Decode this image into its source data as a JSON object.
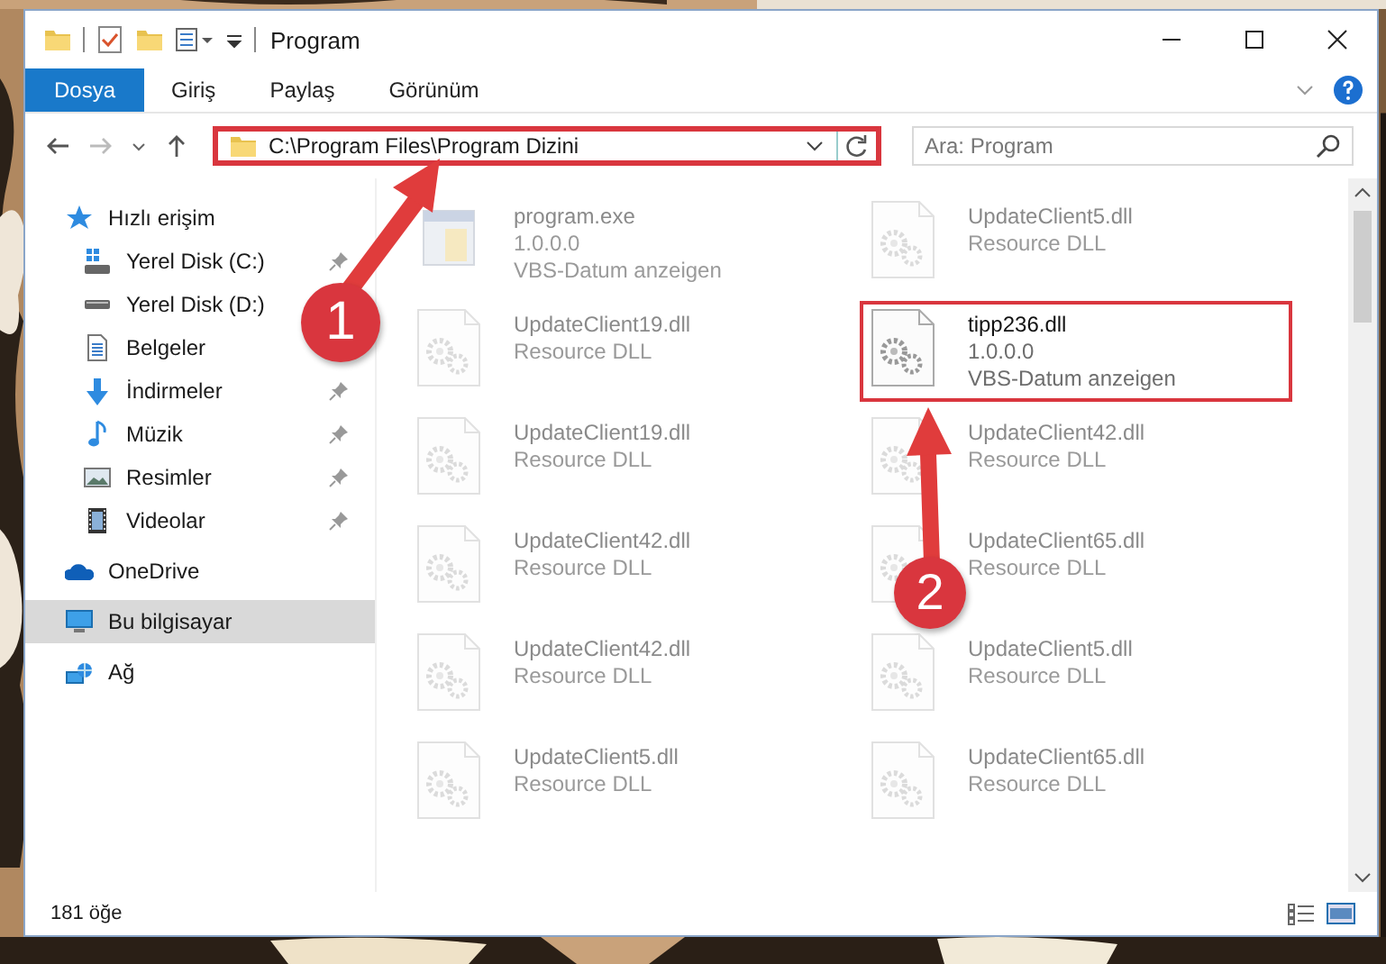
{
  "window": {
    "title": "Program"
  },
  "ribbon_tabs": [
    {
      "label": "Dosya",
      "selected": true
    },
    {
      "label": "Giriş",
      "selected": false
    },
    {
      "label": "Paylaş",
      "selected": false
    },
    {
      "label": "Görünüm",
      "selected": false
    }
  ],
  "address_bar": {
    "value": "C:\\Program Files\\Program Dizini",
    "highlighted": true
  },
  "search": {
    "placeholder": "Ara: Program"
  },
  "sidebar": {
    "items": [
      {
        "label": "Hızlı erişim",
        "kind": "star",
        "selected": false,
        "children": [
          {
            "label": "Yerel Disk (C:)",
            "kind": "drive-win",
            "pinned": true,
            "selected": false
          },
          {
            "label": "Yerel Disk (D:)",
            "kind": "drive",
            "selected": false
          },
          {
            "label": "Belgeler",
            "kind": "document",
            "selected": false
          },
          {
            "label": "İndirmeler",
            "kind": "download",
            "pinned": true,
            "selected": false
          },
          {
            "label": "Müzik",
            "kind": "music",
            "pinned": true,
            "selected": false
          },
          {
            "label": "Resimler",
            "kind": "pictures",
            "pinned": true,
            "selected": false
          },
          {
            "label": "Videolar",
            "kind": "video",
            "pinned": true,
            "selected": false
          }
        ]
      },
      {
        "label": "OneDrive",
        "kind": "cloud",
        "selected": false
      },
      {
        "label": "Bu bilgisayar",
        "kind": "computer",
        "selected": true
      },
      {
        "label": "Ağ",
        "kind": "network",
        "selected": false
      }
    ]
  },
  "files": [
    {
      "name": "program.exe",
      "kind": "exe",
      "details": [
        "1.0.0.0",
        "VBS-Datum anzeigen"
      ],
      "highlighted": false
    },
    {
      "name": "UpdateClient5.dll",
      "kind": "dll",
      "details": [
        "Resource DLL"
      ],
      "highlighted": false
    },
    {
      "name": "UpdateClient19.dll",
      "kind": "dll",
      "details": [
        "Resource DLL"
      ],
      "highlighted": false
    },
    {
      "name": "tipp236.dll",
      "kind": "dll",
      "details": [
        "1.0.0.0",
        "VBS-Datum anzeigen"
      ],
      "highlighted": true
    },
    {
      "name": "UpdateClient19.dll",
      "kind": "dll",
      "details": [
        "Resource DLL"
      ],
      "highlighted": false
    },
    {
      "name": "UpdateClient42.dll",
      "kind": "dll",
      "details": [
        "Resource DLL"
      ],
      "highlighted": false
    },
    {
      "name": "UpdateClient42.dll",
      "kind": "dll",
      "details": [
        "Resource DLL"
      ],
      "highlighted": false
    },
    {
      "name": "UpdateClient65.dll",
      "kind": "dll",
      "details": [
        "Resource DLL"
      ],
      "highlighted": false
    },
    {
      "name": "UpdateClient42.dll",
      "kind": "dll",
      "details": [
        "Resource DLL"
      ],
      "highlighted": false
    },
    {
      "name": "UpdateClient5.dll",
      "kind": "dll",
      "details": [
        "Resource DLL"
      ],
      "highlighted": false
    },
    {
      "name": "UpdateClient5.dll",
      "kind": "dll",
      "details": [
        "Resource DLL"
      ],
      "highlighted": false
    },
    {
      "name": "UpdateClient65.dll",
      "kind": "dll",
      "details": [
        "Resource DLL"
      ],
      "highlighted": false
    }
  ],
  "status_bar": {
    "item_count": "181 öğe"
  },
  "annotations": [
    {
      "label": "1"
    },
    {
      "label": "2"
    }
  ]
}
